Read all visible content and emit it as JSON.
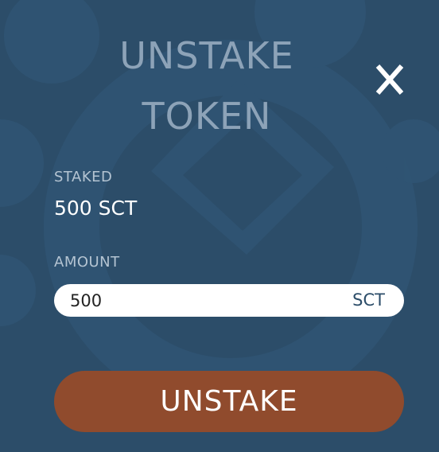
{
  "modal": {
    "title": "UNSTAKE\nTOKEN",
    "close_icon": "close-icon",
    "background_icon": "gear-icon"
  },
  "staked": {
    "label": "STAKED",
    "value": "500 SCT"
  },
  "amount": {
    "label": "AMOUNT",
    "value": "500",
    "unit": "SCT"
  },
  "actions": {
    "unstake_label": "UNSTAKE"
  },
  "colors": {
    "background": "#2c4d69",
    "title": "#8da3b8",
    "button": "#904b2d",
    "field": "#ffffff"
  }
}
